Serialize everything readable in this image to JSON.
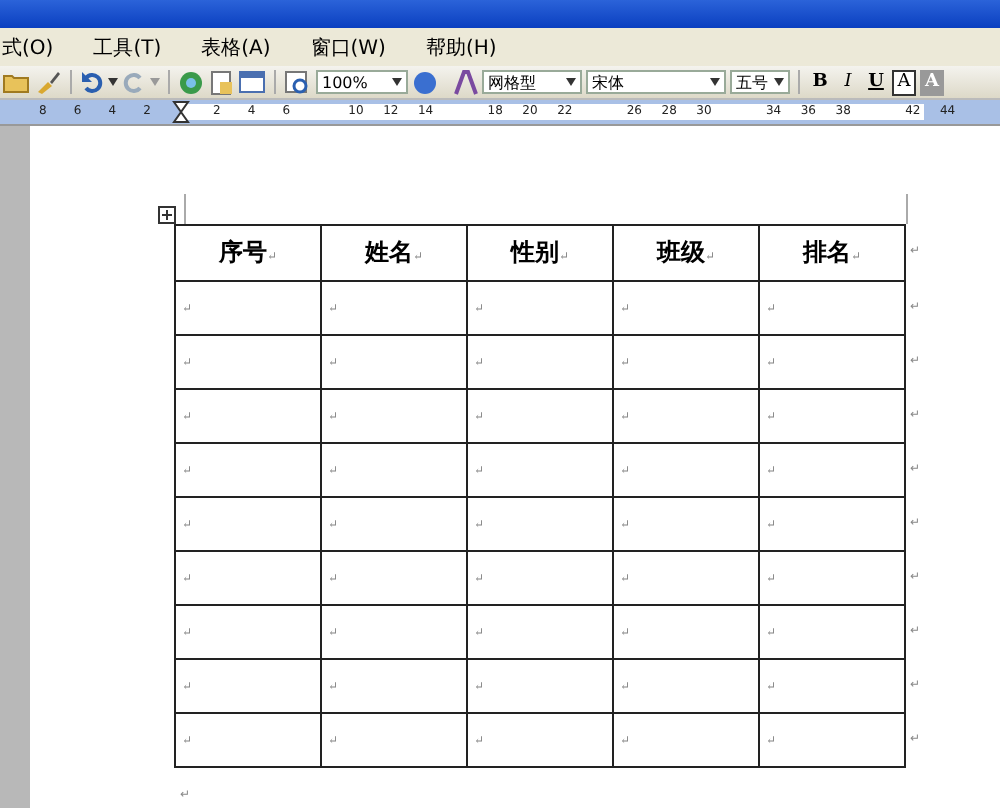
{
  "menu": [
    "式(O)",
    "工具(T)",
    "表格(A)",
    "窗口(W)",
    "帮助(H)"
  ],
  "toolbar": {
    "zoom": "100%",
    "style": "网格型",
    "font": "宋体",
    "size": "五号",
    "format_buttons": [
      "B",
      "I",
      "U",
      "A",
      "A"
    ]
  },
  "ruler": {
    "left_ticks": [
      "8",
      "6",
      "4",
      "2"
    ],
    "right_ticks": [
      "2",
      "4",
      "6",
      "10",
      "12",
      "14",
      "18",
      "20",
      "22",
      "26",
      "28",
      "30",
      "34",
      "36",
      "38",
      "42",
      "44"
    ]
  },
  "table": {
    "columns": [
      {
        "label": "序号",
        "mark": "↵"
      },
      {
        "label": "姓名",
        "mark": "↵"
      },
      {
        "label": "性别",
        "mark": "↵"
      },
      {
        "label": "班级",
        "mark": "↵"
      },
      {
        "label": "排名",
        "mark": "↵"
      }
    ],
    "header_end": "↵",
    "rows": [
      {
        "cells": [
          "↵",
          "↵",
          "↵",
          "↵",
          "↵"
        ],
        "end": "↵"
      },
      {
        "cells": [
          "↵",
          "↵",
          "↵",
          "↵",
          "↵"
        ],
        "end": "↵"
      },
      {
        "cells": [
          "↵",
          "↵",
          "↵",
          "↵",
          "↵"
        ],
        "end": "↵"
      },
      {
        "cells": [
          "↵",
          "↵",
          "↵",
          "↵",
          "↵"
        ],
        "end": "↵"
      },
      {
        "cells": [
          "↵",
          "↵",
          "↵",
          "↵",
          "↵"
        ],
        "end": "↵"
      },
      {
        "cells": [
          "↵",
          "↵",
          "↵",
          "↵",
          "↵"
        ],
        "end": "↵"
      },
      {
        "cells": [
          "↵",
          "↵",
          "↵",
          "↵",
          "↵"
        ],
        "end": "↵"
      },
      {
        "cells": [
          "↵",
          "↵",
          "↵",
          "↵",
          "↵"
        ],
        "end": "↵"
      },
      {
        "cells": [
          "↵",
          "↵",
          "↵",
          "↵",
          "↵"
        ],
        "end": "↵"
      }
    ]
  },
  "after_table": "↵"
}
